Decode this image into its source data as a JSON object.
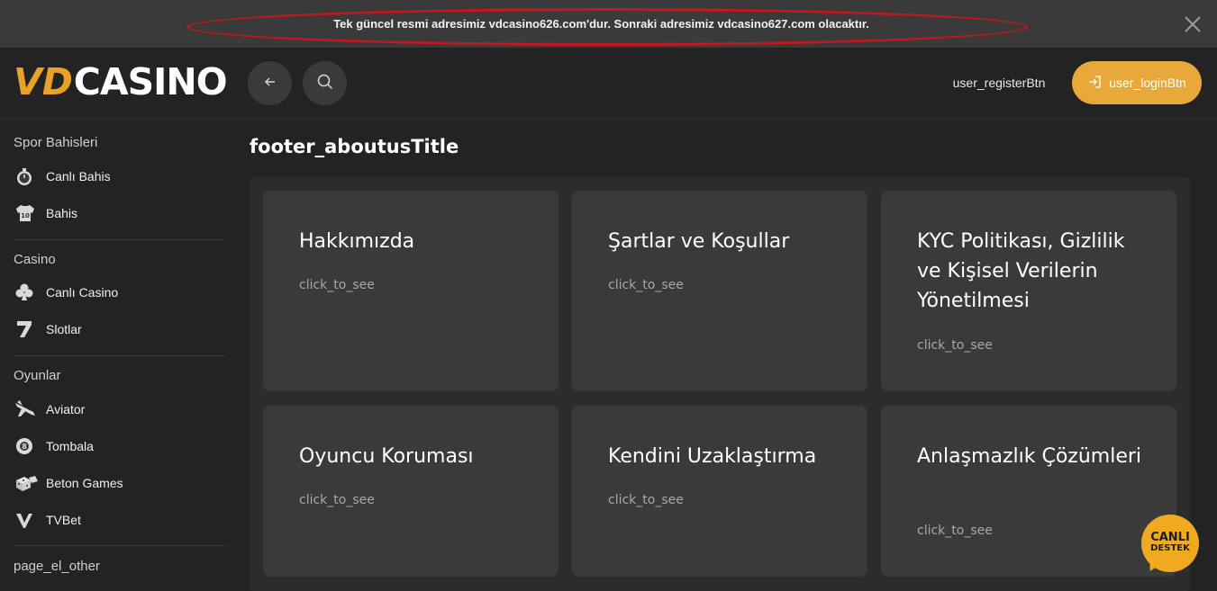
{
  "announcement": {
    "text": "Tek güncel resmi adresimiz vdcasino626.com'dur. Sonraki adresimiz vdcasino627.com olacaktır."
  },
  "header": {
    "logo_v": "V",
    "logo_d": "D",
    "logo_rest": "CASINO",
    "register_label": "user_registerBtn",
    "login_label": "user_loginBtn"
  },
  "sidebar": {
    "sections": [
      {
        "title": "Spor Bahisleri",
        "items": [
          {
            "label": "Canlı Bahis",
            "icon": "stopwatch-icon"
          },
          {
            "label": "Bahis",
            "icon": "jersey-icon"
          }
        ]
      },
      {
        "title": "Casino",
        "items": [
          {
            "label": "Canlı Casino",
            "icon": "club-icon"
          },
          {
            "label": "Slotlar",
            "icon": "seven-icon"
          }
        ]
      },
      {
        "title": "Oyunlar",
        "items": [
          {
            "label": "Aviator",
            "icon": "plane-icon"
          },
          {
            "label": "Tombala",
            "icon": "bingo-ball-icon"
          },
          {
            "label": "Beton Games",
            "icon": "dice-icon"
          },
          {
            "label": "TVBet",
            "icon": "tvbet-icon"
          }
        ]
      },
      {
        "title": "page_el_other",
        "items": []
      }
    ]
  },
  "main": {
    "title": "footer_aboutusTitle",
    "cards": [
      {
        "title": "Hakkımızda",
        "link": "click_to_see"
      },
      {
        "title": "Şartlar ve Koşullar",
        "link": "click_to_see"
      },
      {
        "title": "KYC Politikası, Gizlilik ve Kişisel Verilerin Yönetilmesi",
        "link": "click_to_see"
      },
      {
        "title": "Oyuncu Koruması",
        "link": "click_to_see"
      },
      {
        "title": "Kendini Uzaklaştırma",
        "link": "click_to_see"
      },
      {
        "title": "Anlaşmazlık Çözümleri",
        "link": "click_to_see"
      }
    ]
  },
  "support": {
    "line1": "CANLI",
    "line2": "DESTEK"
  },
  "colors": {
    "accent": "#e8a93a",
    "highlight_oval": "#c8161c",
    "card_bg": "#3a3a3a",
    "page_bg": "#232323"
  }
}
